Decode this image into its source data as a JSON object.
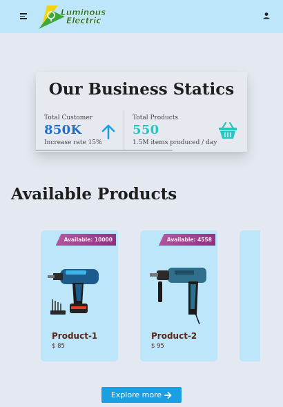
{
  "header": {
    "logo_text_line1": "Luminous",
    "logo_text_line2": "Electric",
    "menu_icon": "hamburger-icon",
    "user_icon": "user-icon"
  },
  "stats": {
    "title": "Our Business Statics",
    "items": [
      {
        "label": "Total Customer",
        "value": "850K",
        "note": "Increase rate 15%",
        "icon": "arrow-up-icon"
      },
      {
        "label": "Total Products",
        "value": "550",
        "note": "1.5M items produced / day",
        "icon": "basket-icon"
      }
    ]
  },
  "products": {
    "title": "Available Products",
    "items": [
      {
        "badge": "Available: 10000",
        "name": "Product-1",
        "price": "$ 85",
        "image": "cordless-drill"
      },
      {
        "badge": "Available: 4558",
        "name": "Product-2",
        "price": "$ 95",
        "image": "hammer-drill"
      }
    ]
  },
  "cta": {
    "label": "Explore more",
    "icon": "arrow-right-icon"
  },
  "colors": {
    "header_bg": "#bde6fb",
    "page_bg": "#e4e9f1",
    "accent_blue": "#1a9fe3",
    "teal": "#23c8c2",
    "badge": "#9b3a8b"
  }
}
